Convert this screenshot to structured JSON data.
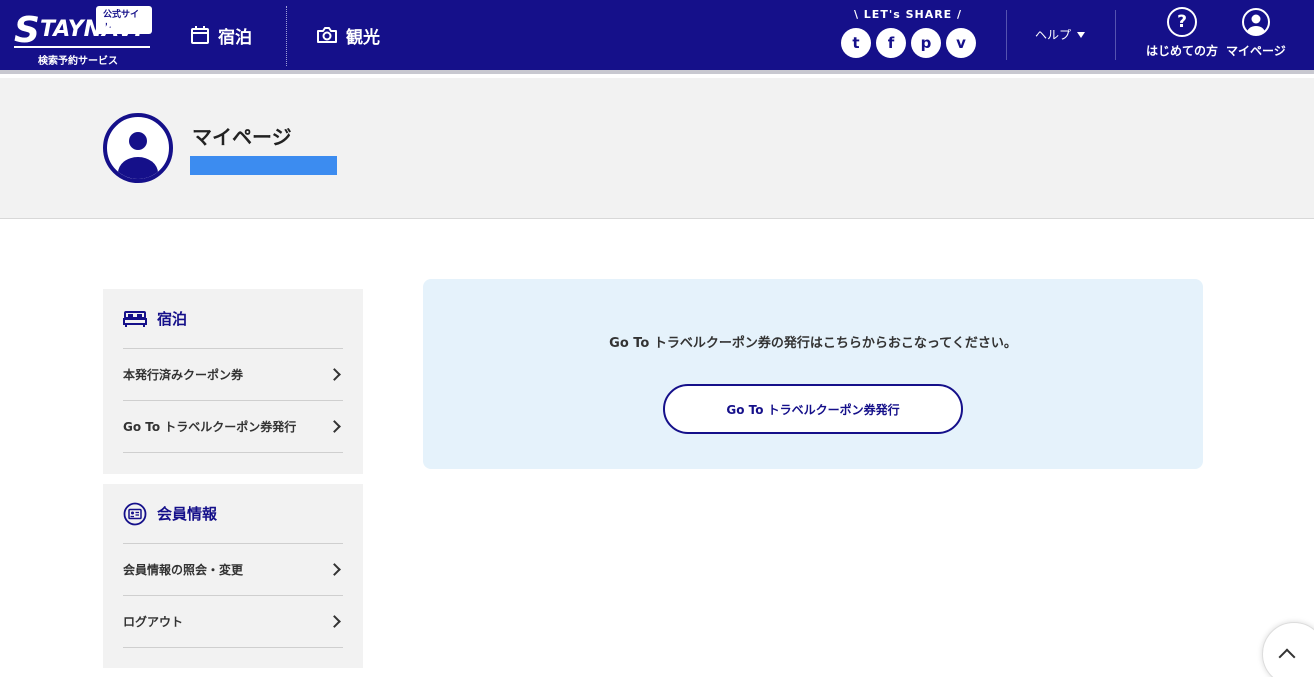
{
  "header": {
    "logo": {
      "badge": "公式サイト",
      "brand_initial": "S",
      "brand_rest": "TAYNAVI",
      "subtitle": "検索予約サービス"
    },
    "nav": [
      {
        "label": "宿泊",
        "icon": "calendar-icon"
      },
      {
        "label": "観光",
        "icon": "camera-icon"
      }
    ],
    "share": {
      "title": "\\ LET's SHARE /",
      "icons": [
        "twitter-icon",
        "facebook-icon",
        "pinterest-icon",
        "pocket-icon"
      ],
      "glyphs": [
        "t",
        "f",
        "p",
        "v"
      ]
    },
    "help_label": "ヘルプ",
    "first_time": {
      "label": "はじめての方",
      "glyph": "?"
    },
    "mypage": {
      "label": "マイページ"
    }
  },
  "title_band": {
    "title": "マイページ"
  },
  "sidebar": {
    "sections": [
      {
        "heading": "宿泊",
        "icon": "bed-icon",
        "links": [
          "本発行済みクーポン券",
          "Go To トラベルクーポン券発行"
        ]
      },
      {
        "heading": "会員情報",
        "icon": "id-card-icon",
        "links": [
          "会員情報の照会・変更",
          "ログアウト"
        ]
      }
    ]
  },
  "main": {
    "message": "Go To トラベルクーポン券の発行はこちらからおこなってください。",
    "button_label": "Go To トラベルクーポン券発行"
  },
  "colors": {
    "brand": "#15108a",
    "user_bar": "#3c8cf0",
    "panel_bg": "#e5f2fb",
    "band_bg": "#f2f2f2"
  }
}
